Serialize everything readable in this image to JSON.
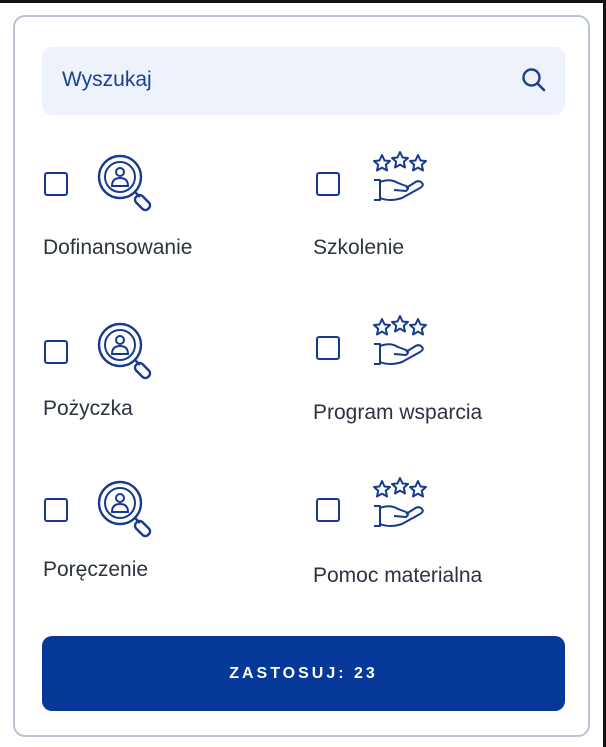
{
  "search": {
    "placeholder": "Wyszukaj"
  },
  "options": [
    {
      "label": "Dofinansowanie",
      "icon": "search-user-icon",
      "checked": false
    },
    {
      "label": "Szkolenie",
      "icon": "hand-stars-icon",
      "checked": false
    },
    {
      "label": "Pożyczka",
      "icon": "search-user-icon",
      "checked": false
    },
    {
      "label": "Program wsparcia",
      "icon": "hand-stars-icon",
      "checked": false
    },
    {
      "label": "Poręczenie",
      "icon": "search-user-icon",
      "checked": false
    },
    {
      "label": "Pomoc materialna",
      "icon": "hand-stars-icon",
      "checked": false
    }
  ],
  "apply": {
    "label": "ZASTOSUJ: 23"
  },
  "colors": {
    "accent": "#06389a",
    "search_bg": "#eef2fb",
    "text": "#2c3340",
    "border": "#b9c3d3"
  }
}
